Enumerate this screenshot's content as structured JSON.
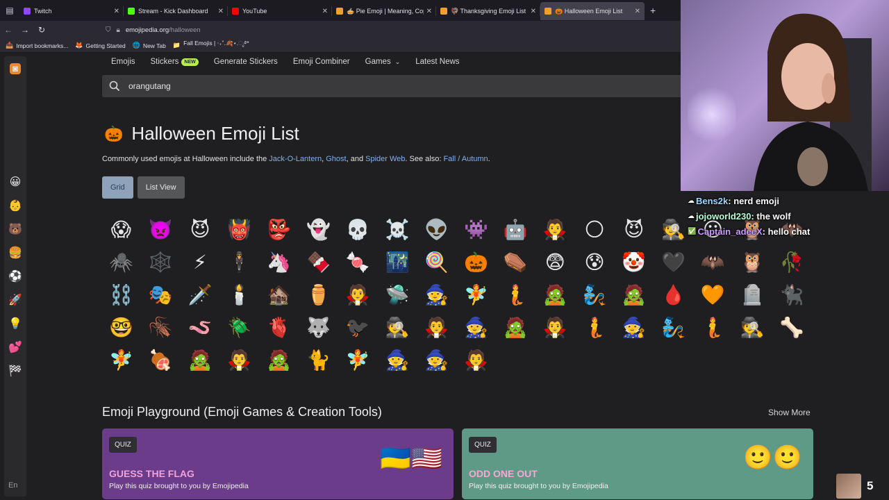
{
  "browser": {
    "tabs": [
      {
        "title": "Twitch",
        "color": "#9146ff",
        "active": false
      },
      {
        "title": "Stream - Kick Dashboard",
        "color": "#53fc18",
        "active": false
      },
      {
        "title": "YouTube",
        "color": "#ff0000",
        "active": false
      },
      {
        "title": "🥧 Pie Emoji | Meaning, Copy A",
        "color": "#f0a030",
        "active": false
      },
      {
        "title": "🦃 Thanksgiving Emoji List",
        "color": "#f0a030",
        "active": false
      },
      {
        "title": "🎃 Halloween Emoji List",
        "color": "#f0a030",
        "active": true
      }
    ],
    "url_domain": "emojipedia.org",
    "url_path": "/halloween",
    "bookmarks": [
      {
        "icon": "📥",
        "label": "Import bookmarks..."
      },
      {
        "icon": "🦊",
        "label": "Getting Started"
      },
      {
        "icon": "🌐",
        "label": "New Tab"
      },
      {
        "icon": "📁",
        "label": "Fall Emojis | ‧₊˚.🍂⋆.ೃ࿔*"
      }
    ]
  },
  "sidebar": {
    "icons": [
      "😀",
      "👶",
      "🐻",
      "🍔",
      "⚽",
      "🚀",
      "💡",
      "💕",
      "🏁"
    ],
    "lang": "En"
  },
  "nav": {
    "items": [
      "Emojis",
      "Stickers",
      "Generate Stickers",
      "Emoji Combiner",
      "Games",
      "Latest News"
    ],
    "new_badge": "NEW"
  },
  "search": {
    "value": "orangutang"
  },
  "page": {
    "title_emoji": "🎃",
    "title": "Halloween Emoji List",
    "intro_prefix": "Commonly used emojis at Halloween include the ",
    "link1": "Jack-O-Lantern",
    "sep1": ", ",
    "link2": "Ghost",
    "sep2": ", and ",
    "link3": "Spider Web",
    "mid": ". See also: ",
    "link4": "Fall / Autumn",
    "end": ".",
    "view_grid": "Grid",
    "view_list": "List View"
  },
  "emojis": [
    "😱",
    "👿",
    "😈",
    "👹",
    "👺",
    "👻",
    "💀",
    "☠️",
    "👽",
    "👾",
    "🤖",
    "🧛",
    "🌕",
    "😈",
    "🕵️",
    "😶",
    "🦉",
    "🦇",
    "🕷️",
    "🕸️",
    "⚡",
    "🕴️",
    "🦄",
    "🍫",
    "🍬",
    "🌃",
    "🍭",
    "🎃",
    "⚰️",
    "😨",
    "😰",
    "🤡",
    "🖤",
    "🦇",
    "🦉",
    "🥀",
    "⛓️",
    "🎭",
    "🗡️",
    "🕯️",
    "🏚️",
    "⚱️",
    "🧛",
    "🛸",
    "🧙",
    "🧚",
    "🧜",
    "🧟",
    "🧞",
    "🧟",
    "🩸",
    "🧡",
    "🪦",
    "🐈‍⬛",
    "🤓",
    "🪳",
    "🪱",
    "🪲",
    "🫀",
    "🐺",
    "🐦‍⬛",
    "🕵️",
    "🧛",
    "🧙",
    "🧟",
    "🧛",
    "🧜",
    "🧙",
    "🧞",
    "🧜",
    "🕵️",
    "🦴",
    "🧚",
    "🍖",
    "🧟",
    "🧛",
    "🧟",
    "🐈",
    "🧚",
    "🧙",
    "🧙",
    "🧛"
  ],
  "playground": {
    "title": "Emoji Playground (Emoji Games & Creation Tools)",
    "show_more": "Show More",
    "cards": [
      {
        "tag": "QUIZ",
        "title": "GUESS THE FLAG",
        "subtitle": "Play this quiz brought to you by Emojipedia",
        "art": "🇺🇦🇺🇸"
      },
      {
        "tag": "QUIZ",
        "title": "ODD ONE OUT",
        "subtitle": "Play this quiz brought to you by Emojipedia",
        "art": "🙂🙂"
      }
    ]
  },
  "stream": {
    "chat": [
      {
        "user": "Bens2k",
        "message": "nerd emoji"
      },
      {
        "user": "jojoworld230",
        "message": "the wolf"
      },
      {
        "user": "Captain_adeeX",
        "message": "hello chat"
      }
    ],
    "viewer_count": "5"
  }
}
